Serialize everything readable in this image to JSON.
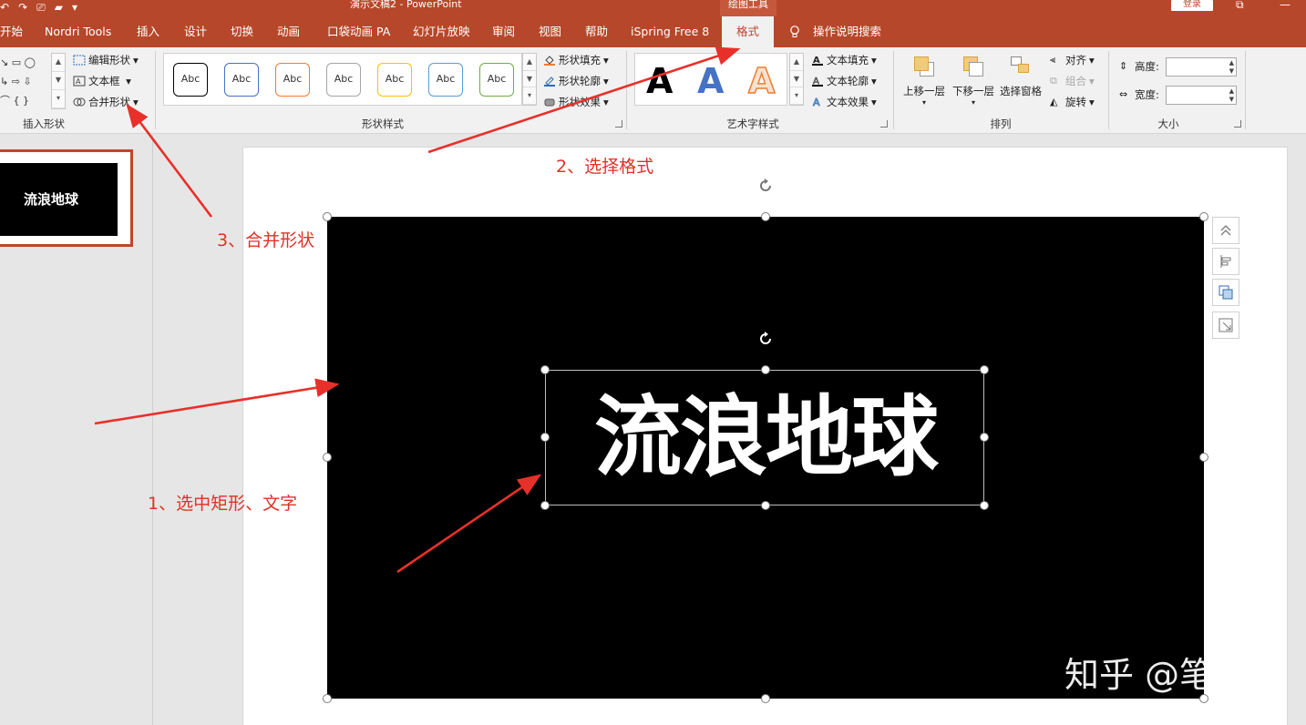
{
  "titlebar": {
    "doc_title": "演示文稿2  -  PowerPoint",
    "context_tab": "绘图工具",
    "login": "登录",
    "restore_icon": "restore-icon",
    "minimize_icon": "minimize-icon"
  },
  "tabs": {
    "home": "开始",
    "nordri": "Nordri Tools",
    "insert": "插入",
    "design": "设计",
    "transitions": "切换",
    "animations": "动画",
    "pocket": "口袋动画 PA",
    "slideshow": "幻灯片放映",
    "review": "审阅",
    "view": "视图",
    "help": "帮助",
    "ispring": "iSpring Free 8",
    "format": "格式",
    "tell_me": "操作说明搜索"
  },
  "ribbon": {
    "insert_shapes": {
      "label": "插入形状",
      "edit_shape": "编辑形状",
      "text_box": "文本框",
      "merge_shapes": "合并形状",
      "gallery_rows": [
        "↘ ▭ ◯",
        "↳ ⇨ ⇩",
        "⌒ {  }"
      ]
    },
    "shape_styles": {
      "label": "形状样式",
      "samples": [
        "Abc",
        "Abc",
        "Abc",
        "Abc",
        "Abc",
        "Abc",
        "Abc"
      ],
      "sample_colors": [
        "#000000",
        "#4472c4",
        "#ed7d31",
        "#a5a5a5",
        "#ffc000",
        "#5b9bd5",
        "#70ad47"
      ],
      "fill": "形状填充",
      "outline": "形状轮廓",
      "effects": "形状效果"
    },
    "wordart": {
      "label": "艺术字样式",
      "samples": [
        "A",
        "A",
        "A"
      ],
      "text_fill": "文本填充",
      "text_outline": "文本轮廓",
      "text_effects": "文本效果"
    },
    "arrange": {
      "label": "排列",
      "bring_forward": "上移一层",
      "send_backward": "下移一层",
      "selection_pane": "选择窗格",
      "align": "对齐",
      "group": "组合",
      "rotate": "旋转"
    },
    "size": {
      "label": "大小",
      "height": "高度:",
      "width": "宽度:"
    }
  },
  "thumbnail": {
    "text": "流浪地球"
  },
  "slide": {
    "title_text": "流浪地球"
  },
  "annotations": {
    "step1": "1、选中矩形、文字",
    "step2": "2、选择格式",
    "step3": "3、合并形状",
    "color": "#e03127"
  },
  "watermark": "知乎 @笔书",
  "colors": {
    "accent": "#b7472a",
    "ribbon_bg": "#f1f1f1"
  }
}
